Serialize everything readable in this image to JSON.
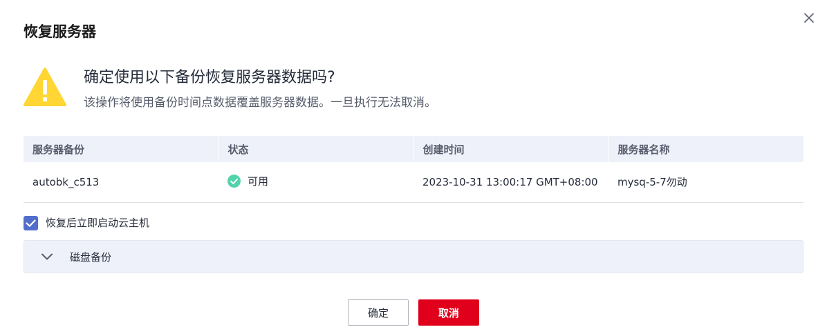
{
  "dialog": {
    "title": "恢复服务器",
    "close_icon": "close-icon"
  },
  "warning": {
    "icon": "warning-triangle-icon",
    "icon_color": "#ffd633",
    "title": "确定使用以下备份恢复服务器数据吗?",
    "description": "该操作将使用备份时间点数据覆盖服务器数据。一旦执行无法取消。"
  },
  "table": {
    "headers": [
      "服务器备份",
      "状态",
      "创建时间",
      "服务器名称"
    ],
    "rows": [
      {
        "backup": "autobk_c513",
        "status_icon": "check-circle-icon",
        "status": "可用",
        "created_at": "2023-10-31 13:00:17 GMT+08:00",
        "server_name": "mysq-5-7勿动"
      }
    ]
  },
  "start_after_restore": {
    "checked": true,
    "label": "恢复后立即启动云主机"
  },
  "disk_backup": {
    "icon": "chevron-down-icon",
    "label": "磁盘备份"
  },
  "buttons": {
    "confirm": "确定",
    "cancel": "取消"
  },
  "colors": {
    "accent": "#526ecc",
    "danger": "#e0001b",
    "success": "#50d4ab",
    "header_bg": "#eff1fa"
  }
}
